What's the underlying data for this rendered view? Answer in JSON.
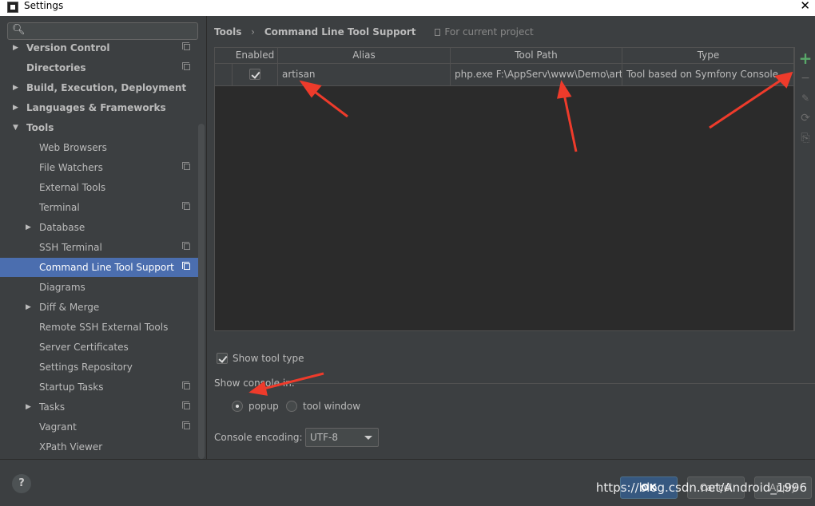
{
  "window": {
    "title": "Settings"
  },
  "search": {
    "placeholder": "",
    "value": ""
  },
  "tree": [
    {
      "label": "Version Control",
      "bold": true,
      "indent": 0,
      "arrow": "right",
      "copy": true,
      "selected": false
    },
    {
      "label": "Directories",
      "bold": true,
      "indent": 0,
      "arrow": "",
      "copy": true,
      "selected": false
    },
    {
      "label": "Build, Execution, Deployment",
      "bold": true,
      "indent": 0,
      "arrow": "right",
      "copy": false,
      "selected": false
    },
    {
      "label": "Languages & Frameworks",
      "bold": true,
      "indent": 0,
      "arrow": "right",
      "copy": false,
      "selected": false
    },
    {
      "label": "Tools",
      "bold": true,
      "indent": 0,
      "arrow": "down",
      "copy": false,
      "selected": false
    },
    {
      "label": "Web Browsers",
      "bold": false,
      "indent": 1,
      "arrow": "",
      "copy": false,
      "selected": false
    },
    {
      "label": "File Watchers",
      "bold": false,
      "indent": 1,
      "arrow": "",
      "copy": true,
      "selected": false
    },
    {
      "label": "External Tools",
      "bold": false,
      "indent": 1,
      "arrow": "",
      "copy": false,
      "selected": false
    },
    {
      "label": "Terminal",
      "bold": false,
      "indent": 1,
      "arrow": "",
      "copy": true,
      "selected": false
    },
    {
      "label": "Database",
      "bold": false,
      "indent": 1,
      "arrow": "right",
      "copy": false,
      "selected": false
    },
    {
      "label": "SSH Terminal",
      "bold": false,
      "indent": 1,
      "arrow": "",
      "copy": true,
      "selected": false
    },
    {
      "label": "Command Line Tool Support",
      "bold": false,
      "indent": 1,
      "arrow": "",
      "copy": true,
      "selected": true
    },
    {
      "label": "Diagrams",
      "bold": false,
      "indent": 1,
      "arrow": "",
      "copy": false,
      "selected": false
    },
    {
      "label": "Diff & Merge",
      "bold": false,
      "indent": 1,
      "arrow": "right",
      "copy": false,
      "selected": false
    },
    {
      "label": "Remote SSH External Tools",
      "bold": false,
      "indent": 1,
      "arrow": "",
      "copy": false,
      "selected": false
    },
    {
      "label": "Server Certificates",
      "bold": false,
      "indent": 1,
      "arrow": "",
      "copy": false,
      "selected": false
    },
    {
      "label": "Settings Repository",
      "bold": false,
      "indent": 1,
      "arrow": "",
      "copy": false,
      "selected": false
    },
    {
      "label": "Startup Tasks",
      "bold": false,
      "indent": 1,
      "arrow": "",
      "copy": true,
      "selected": false
    },
    {
      "label": "Tasks",
      "bold": false,
      "indent": 1,
      "arrow": "right",
      "copy": true,
      "selected": false
    },
    {
      "label": "Vagrant",
      "bold": false,
      "indent": 1,
      "arrow": "",
      "copy": true,
      "selected": false
    },
    {
      "label": "XPath Viewer",
      "bold": false,
      "indent": 1,
      "arrow": "",
      "copy": false,
      "selected": false
    }
  ],
  "breadcrumb": {
    "parent": "Tools",
    "separator": "›",
    "current": "Command Line Tool Support",
    "scope": "For current project"
  },
  "table": {
    "columns": [
      "Enabled",
      "Alias",
      "Tool Path",
      "Type"
    ],
    "rows": [
      {
        "enabled": true,
        "alias": "artisan",
        "tool_path": "php.exe F:\\AppServ\\www\\Demo\\arti...",
        "type": "Tool based on Symfony Console"
      }
    ]
  },
  "toolbar": {
    "add": "+",
    "remove": "−",
    "edit": "✎",
    "refresh": "⟳",
    "export": "⎘"
  },
  "options": {
    "show_tool_type_label": "Show tool type",
    "show_tool_type_checked": true,
    "show_console_label": "Show console in:",
    "radio_popup_label": "popup",
    "radio_tool_window_label": "tool window",
    "selected_console": "popup",
    "console_encoding_label": "Console encoding:",
    "console_encoding_value": "UTF-8"
  },
  "buttons": {
    "help": "?",
    "ok": "OK",
    "cancel": "Cancel",
    "apply": "Apply"
  },
  "watermark": "https://blog.csdn.net/Android_1996",
  "colors": {
    "accent": "#4b6eaf",
    "add_green": "#59a869",
    "arrow_red": "#ee3b2b",
    "background": "#3c3f41"
  }
}
